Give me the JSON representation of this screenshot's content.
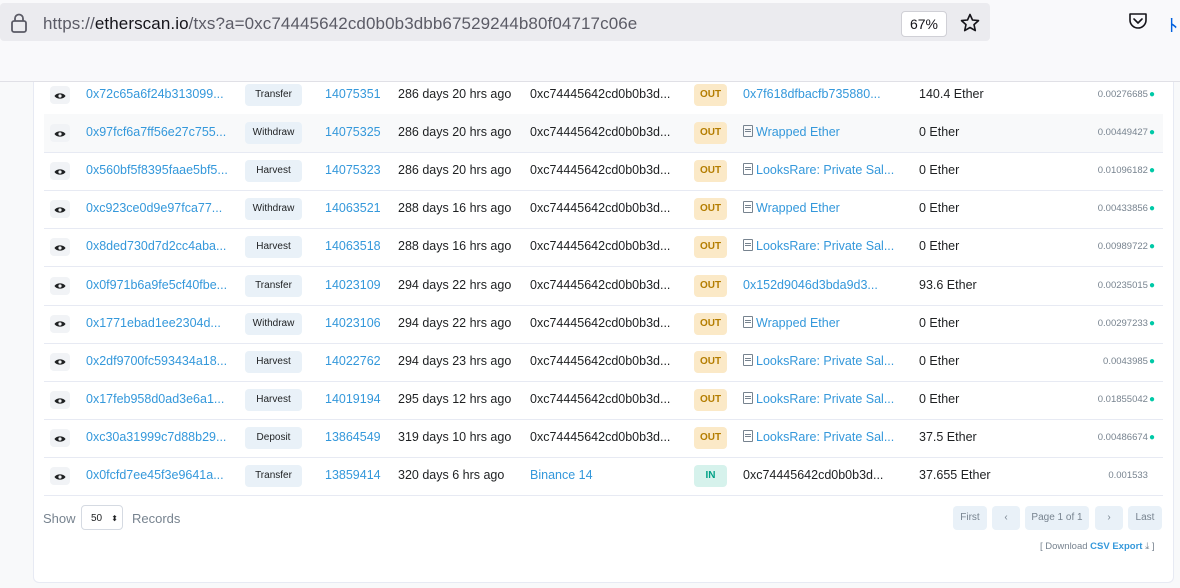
{
  "browser": {
    "url_scheme": "https://",
    "url_host": "etherscan.io",
    "url_path": "/txs?a=0xc74445642cd0b0b3dbb67529244b80f04717c06e",
    "zoom": "67%"
  },
  "rows": [
    {
      "hash": "0x72c65a6f24b313099...",
      "method": "Transfer",
      "block": "14075351",
      "age": "286 days 20 hrs ago",
      "from": "0xc74445642cd0b0b3d...",
      "dir": "OUT",
      "to": "0x7f618dfbacfb735880...",
      "to_contract": false,
      "value": "140.4 Ether",
      "fee": "0.00276685"
    },
    {
      "hash": "0x97fcf6a7ff56e27c755...",
      "method": "Withdraw",
      "block": "14075325",
      "age": "286 days 20 hrs ago",
      "from": "0xc74445642cd0b0b3d...",
      "dir": "OUT",
      "to": "Wrapped Ether",
      "to_contract": true,
      "value": "0 Ether",
      "fee": "0.00449427"
    },
    {
      "hash": "0x560bf5f8395faae5bf5...",
      "method": "Harvest",
      "block": "14075323",
      "age": "286 days 20 hrs ago",
      "from": "0xc74445642cd0b0b3d...",
      "dir": "OUT",
      "to": "LooksRare: Private Sal...",
      "to_contract": true,
      "value": "0 Ether",
      "fee": "0.01096182"
    },
    {
      "hash": "0xc923ce0d9e97fca77...",
      "method": "Withdraw",
      "block": "14063521",
      "age": "288 days 16 hrs ago",
      "from": "0xc74445642cd0b0b3d...",
      "dir": "OUT",
      "to": "Wrapped Ether",
      "to_contract": true,
      "value": "0 Ether",
      "fee": "0.00433856"
    },
    {
      "hash": "0x8ded730d7d2cc4aba...",
      "method": "Harvest",
      "block": "14063518",
      "age": "288 days 16 hrs ago",
      "from": "0xc74445642cd0b0b3d...",
      "dir": "OUT",
      "to": "LooksRare: Private Sal...",
      "to_contract": true,
      "value": "0 Ether",
      "fee": "0.00989722"
    },
    {
      "hash": "0x0f971b6a9fe5cf40fbe...",
      "method": "Transfer",
      "block": "14023109",
      "age": "294 days 22 hrs ago",
      "from": "0xc74445642cd0b0b3d...",
      "dir": "OUT",
      "to": "0x152d9046d3bda9d3...",
      "to_contract": false,
      "value": "93.6 Ether",
      "fee": "0.00235015"
    },
    {
      "hash": "0x1771ebad1ee2304d...",
      "method": "Withdraw",
      "block": "14023106",
      "age": "294 days 22 hrs ago",
      "from": "0xc74445642cd0b0b3d...",
      "dir": "OUT",
      "to": "Wrapped Ether",
      "to_contract": true,
      "value": "0 Ether",
      "fee": "0.00297233"
    },
    {
      "hash": "0x2df9700fc593434a18...",
      "method": "Harvest",
      "block": "14022762",
      "age": "294 days 23 hrs ago",
      "from": "0xc74445642cd0b0b3d...",
      "dir": "OUT",
      "to": "LooksRare: Private Sal...",
      "to_contract": true,
      "value": "0 Ether",
      "fee": "0.0043985"
    },
    {
      "hash": "0x17feb958d0ad3e6a1...",
      "method": "Harvest",
      "block": "14019194",
      "age": "295 days 12 hrs ago",
      "from": "0xc74445642cd0b0b3d...",
      "dir": "OUT",
      "to": "LooksRare: Private Sal...",
      "to_contract": true,
      "value": "0 Ether",
      "fee": "0.01855042"
    },
    {
      "hash": "0xc30a31999c7d88b29...",
      "method": "Deposit",
      "block": "13864549",
      "age": "319 days 10 hrs ago",
      "from": "0xc74445642cd0b0b3d...",
      "dir": "OUT",
      "to": "LooksRare: Private Sal...",
      "to_contract": true,
      "value": "37.5 Ether",
      "fee": "0.00486674"
    },
    {
      "hash": "0x0fcfd7ee45f3e9641a...",
      "method": "Transfer",
      "block": "13859414",
      "age": "320 days 6 hrs ago",
      "from": "Binance 14",
      "from_link": true,
      "dir": "IN",
      "to": "0xc74445642cd0b0b3d...",
      "to_contract": false,
      "to_plain": true,
      "value": "37.655 Ether",
      "fee": "0.001533",
      "no_bulb": true
    }
  ],
  "footer": {
    "show_label": "Show",
    "page_size": "50",
    "records_label": "Records",
    "first": "First",
    "page_info": "Page 1 of 1",
    "last": "Last",
    "download_prefix": "[ Download",
    "download_link": "CSV Export",
    "download_suffix": "]"
  },
  "colors": {
    "link": "#3498db",
    "out_bg": "#fbe9c7",
    "in_bg": "#d6f2ec",
    "fee_icon": "#00c9a7"
  }
}
